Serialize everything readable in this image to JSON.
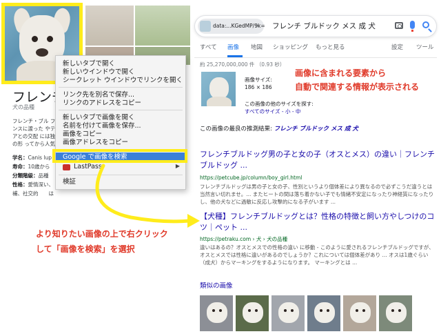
{
  "knowledge_panel": {
    "title": "フレンチ",
    "subtitle": "犬の品種",
    "description": "フレンチ・ブル フランスに渡った やテリアとの交配 には独特の形 ってから人気が",
    "facts": [
      {
        "label": "学名：",
        "value": "Canis lup"
      },
      {
        "label": "寿命：",
        "value": "10歳から"
      },
      {
        "label": "分類階級：",
        "value": "品種"
      },
      {
        "label": "性格：",
        "value": "愛情深い、"
      },
      {
        "label": "",
        "value": "補、社交的　　は"
      }
    ]
  },
  "context_menu": {
    "items": [
      "新しいタブで開く",
      "新しいウインドウで開く",
      "シークレット ウインドウでリンクを開く",
      "リンク先を別名で保存...",
      "リンクのアドレスをコピー",
      "新しいタブで画像を開く",
      "名前を付けて画像を保存...",
      "画像をコピー",
      "画像アドレスをコピー"
    ],
    "highlighted": "Google で画像を検索",
    "lastpass": "LastPass",
    "inspect": "検証"
  },
  "annotations": {
    "right_note_line1": "画像に含まれる要素から",
    "right_note_line2": "自動で関連する情報が表示される",
    "left_note_line1": "より知りたい画像の上で右クリック",
    "left_note_line2": "して「画像を検索」を選択"
  },
  "search": {
    "chip_text": "data:...KGedMP/9k=",
    "chip_close": "×",
    "query": "フレンチ ブルドック メス 成 犬"
  },
  "tabs": {
    "items": [
      "すべて",
      "画像",
      "地図",
      "ショッピング",
      "もっと見る"
    ],
    "active": "画像",
    "right": [
      "設定",
      "ツール"
    ]
  },
  "stats": "約 25,270,000,000 件 （0.93 秒）",
  "image_info": {
    "size_label": "画像サイズ:",
    "size_value": "186 × 186",
    "other_label": "この画像の他のサイズを探す:",
    "all_sizes": "すべてのサイズ",
    "small": "小",
    "medium": "中",
    "sep": " - "
  },
  "best_guess": {
    "label": "この画像の最良の推測結果: ",
    "value": "フレンチ ブルドック メス 成 犬"
  },
  "results": [
    {
      "title": "フレンチブルドッグ男の子と女の子（オスとメス）の違い｜フレンチブルドッグ ...",
      "url": "https://petcube.jp/column/boy_girl.html",
      "snippet": "フレンチブルドッグは男の子と女の子、性別というより個体差により異なるので必ずこうだ違うとは当然言い切れませ。... またヒートの間は落ち着かない子でも情緒不安定になったり神経質になったりし、他の犬などに過敏に反応し攻撃的になる子がいます ..."
    },
    {
      "title": "【犬種】フレンチブルドッグとは？性格の特徴と飼い方やしつけのコツ｜ペット ...",
      "url": "https://petraku.com › 犬 › 犬の品種",
      "snippet": "違いはあるの？オスとメスでの性格の違い に移動 - このように愛されるフレンチブルドッグですが、オスとメスでは性格に違いがあるのでしょうか？これについては個体差があり ... オスは1歳ぐらい（成犬）からマーキングをするようになります。 マーキングとは ..."
    }
  ],
  "similar_title": "類似の画像",
  "colors": {
    "highlight_yellow": "#ffec1c",
    "annotation_red": "#e03a2a",
    "link_blue": "#1a0dab",
    "menu_highlight": "#3b80d9"
  }
}
